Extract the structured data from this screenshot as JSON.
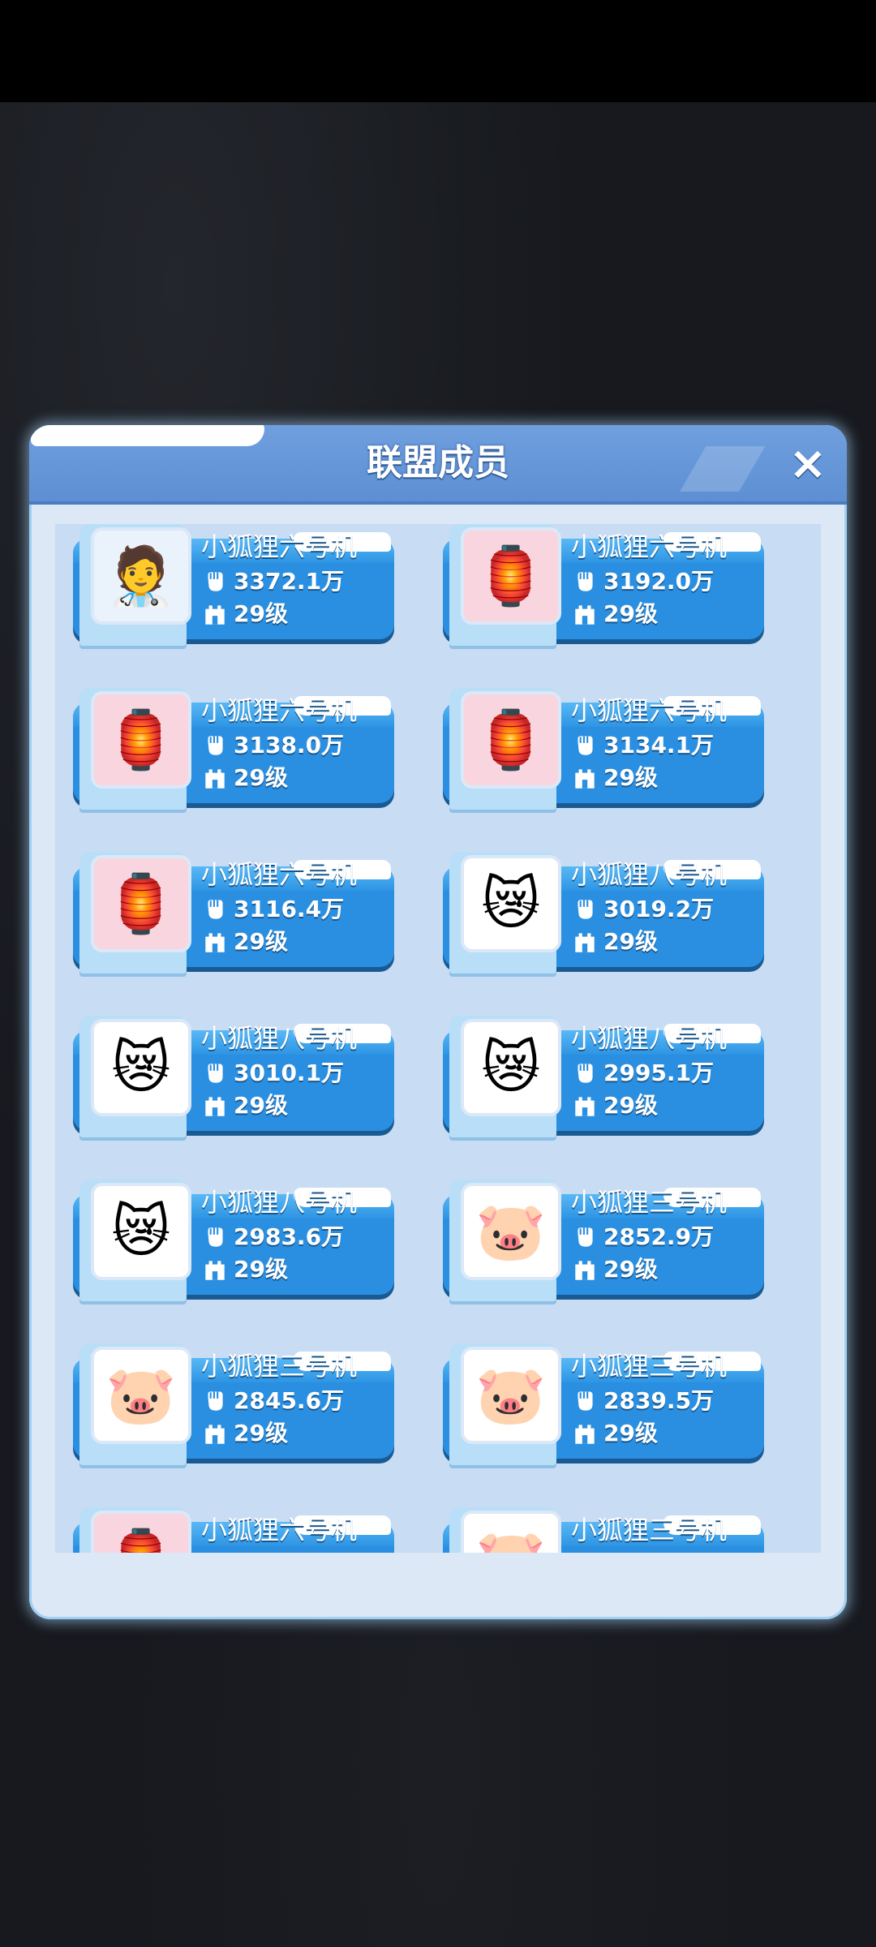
{
  "dialog": {
    "title": "联盟成员",
    "close_icon": "×"
  },
  "members": [
    {
      "name": "小狐狸六号机",
      "power": "3372.1万",
      "level": "29级",
      "avatar": "doctor-ghost"
    },
    {
      "name": "小狐狸六号机",
      "power": "3192.0万",
      "level": "29级",
      "avatar": "newyear-lantern"
    },
    {
      "name": "小狐狸六号机",
      "power": "3138.0万",
      "level": "29级",
      "avatar": "newyear-lantern"
    },
    {
      "name": "小狐狸六号机",
      "power": "3134.1万",
      "level": "29级",
      "avatar": "newyear-lantern"
    },
    {
      "name": "小狐狸六号机",
      "power": "3116.4万",
      "level": "29级",
      "avatar": "newyear-lantern"
    },
    {
      "name": "小狐狸八号机",
      "power": "3019.2万",
      "level": "29级",
      "avatar": "crying-cat"
    },
    {
      "name": "小狐狸八号机",
      "power": "3010.1万",
      "level": "29级",
      "avatar": "crying-cat"
    },
    {
      "name": "小狐狸八号机",
      "power": "2995.1万",
      "level": "29级",
      "avatar": "crying-cat"
    },
    {
      "name": "小狐狸八号机",
      "power": "2983.6万",
      "level": "29级",
      "avatar": "crying-cat"
    },
    {
      "name": "小狐狸三号机",
      "power": "2852.9万",
      "level": "29级",
      "avatar": "blushing-pig"
    },
    {
      "name": "小狐狸三号机",
      "power": "2845.6万",
      "level": "29级",
      "avatar": "blushing-pig"
    },
    {
      "name": "小狐狸三号机",
      "power": "2839.5万",
      "level": "29级",
      "avatar": "blushing-pig"
    },
    {
      "name": "小狐狸六号机",
      "power": "",
      "level": "",
      "avatar": "newyear-lantern"
    },
    {
      "name": "小狐狸三号机",
      "power": "",
      "level": "",
      "avatar": "blushing-pig"
    }
  ],
  "icons": {
    "power": "fist-icon",
    "level": "castle-icon"
  },
  "colors": {
    "header": "#5d8fd3",
    "card": "#2a8fe1",
    "panel": "#dce8f6"
  }
}
